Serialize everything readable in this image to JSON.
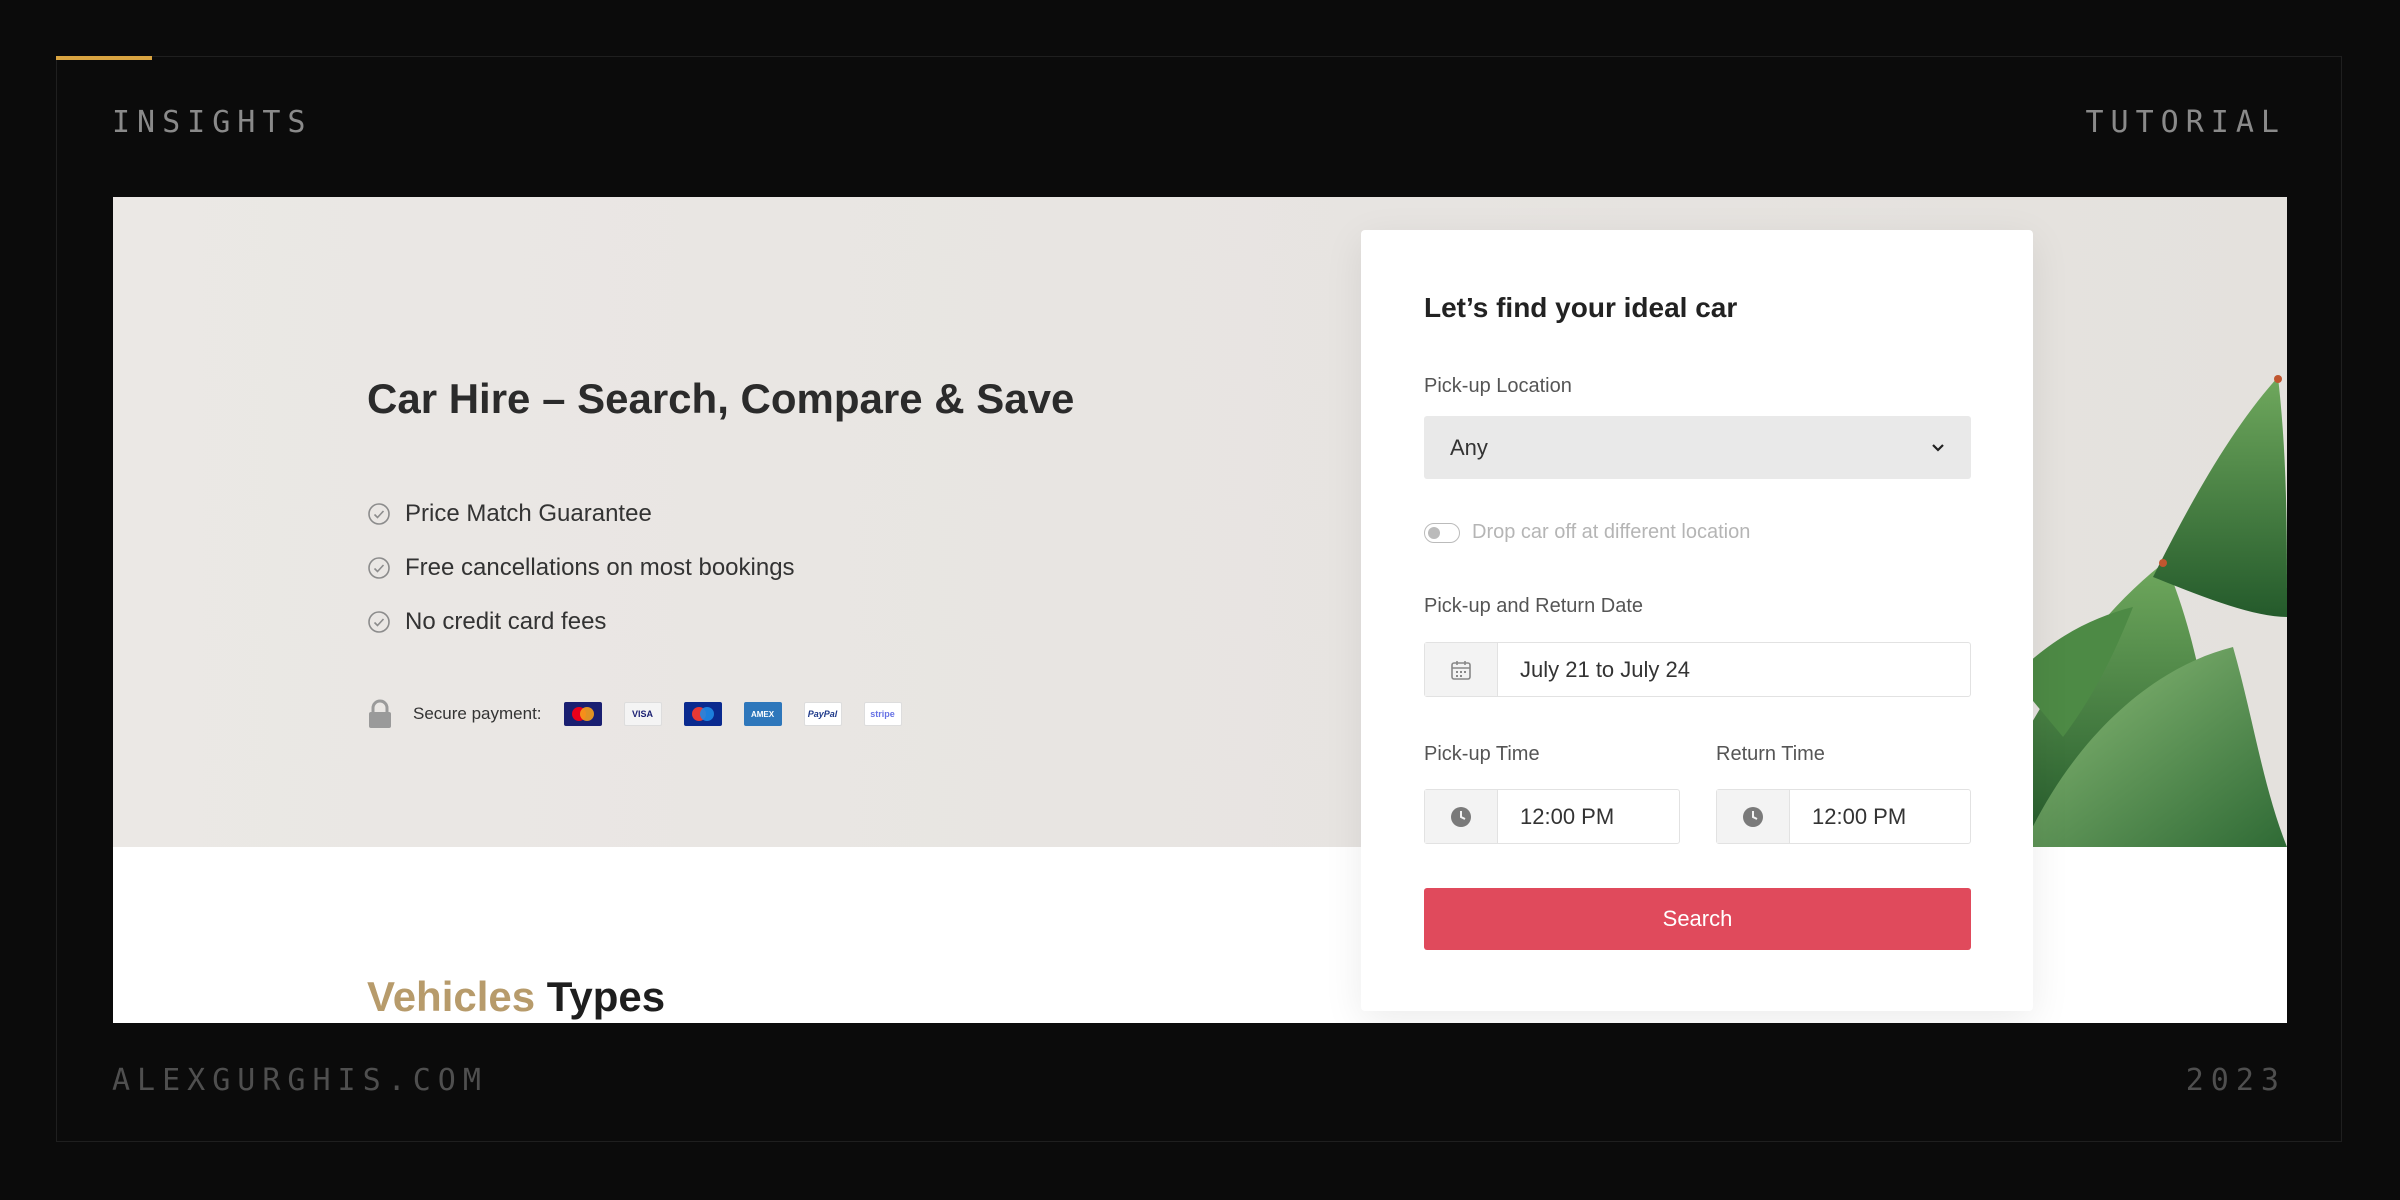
{
  "frame": {
    "top_left": "INSIGHTS",
    "top_right": "TUTORIAL",
    "bottom_left": "ALEXGURGHIS.COM",
    "bottom_right": "2023",
    "accent_color": "#d9a441"
  },
  "hero": {
    "title": "Car Hire – Search, Compare & Save",
    "features": [
      "Price Match Guarantee",
      "Free cancellations on most bookings",
      "No credit card fees"
    ],
    "secure_payment_label": "Secure payment:",
    "payment_logos": [
      {
        "name": "mastercard",
        "text": "Mastercard"
      },
      {
        "name": "visa",
        "text": "VISA"
      },
      {
        "name": "maestro",
        "text": "Maestro"
      },
      {
        "name": "amex",
        "text": "AMEX"
      },
      {
        "name": "paypal",
        "text": "PayPal"
      },
      {
        "name": "stripe",
        "text": "stripe"
      }
    ]
  },
  "search_card": {
    "title": "Let’s find your ideal car",
    "pickup_location_label": "Pick-up Location",
    "pickup_location_value": "Any",
    "dropoff_toggle_label": "Drop car off at different location",
    "dates_label": "Pick-up and Return Date",
    "dates_value": "July 21 to July 24",
    "pickup_time_label": "Pick-up Time",
    "pickup_time_value": "12:00 PM",
    "return_time_label": "Return Time",
    "return_time_value": "12:00 PM",
    "search_button": "Search",
    "button_color": "#e04a5c"
  },
  "vehicles_section": {
    "title_highlight": "Vehicles",
    "title_rest": "Types",
    "highlight_color": "#b79b6b"
  }
}
